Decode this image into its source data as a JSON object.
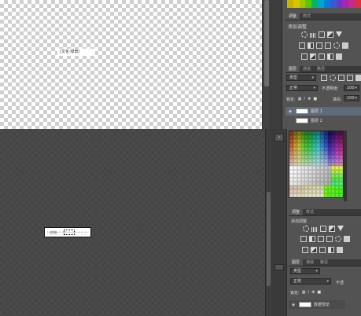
{
  "top_canvas": {
    "layer_text": "(文化·绿景)"
  },
  "top_panels": {
    "tabs": [
      "调整",
      "样式"
    ],
    "title": "添加调整",
    "layers_tabs": [
      "图层",
      "通道",
      "路径"
    ],
    "filter_label": "类型",
    "blend_mode": "正常",
    "opacity_label": "不透明度:",
    "opacity_value": "100",
    "lock_label": "锁定:",
    "fill_label": "填充:",
    "fill_value": "100",
    "layers": [
      {
        "name": "图层 1",
        "selected": true
      },
      {
        "name": "图层 2",
        "selected": false
      }
    ]
  },
  "bottom_panels": {
    "tabs": [
      "调整",
      "样式"
    ],
    "title": "添加调整",
    "layers_tabs": [
      "图层",
      "通道",
      "路径"
    ],
    "filter_label": "类型",
    "blend_mode": "正常",
    "opacity_label": "不透",
    "lock_label": "锁定:",
    "layers": [
      {
        "name": "数据预览",
        "selected": false
      }
    ]
  },
  "dock": {
    "collapse_label": "«"
  },
  "mini_doc": {
    "label": "(文化·"
  },
  "swatch_colors": [
    "#c8b400",
    "#d8c400",
    "#a0c800",
    "#58c800",
    "#00b860",
    "#00a8c8",
    "#0080d8",
    "#3858d8",
    "#6838c8",
    "#a028b8",
    "#c82888",
    "#d83040"
  ]
}
